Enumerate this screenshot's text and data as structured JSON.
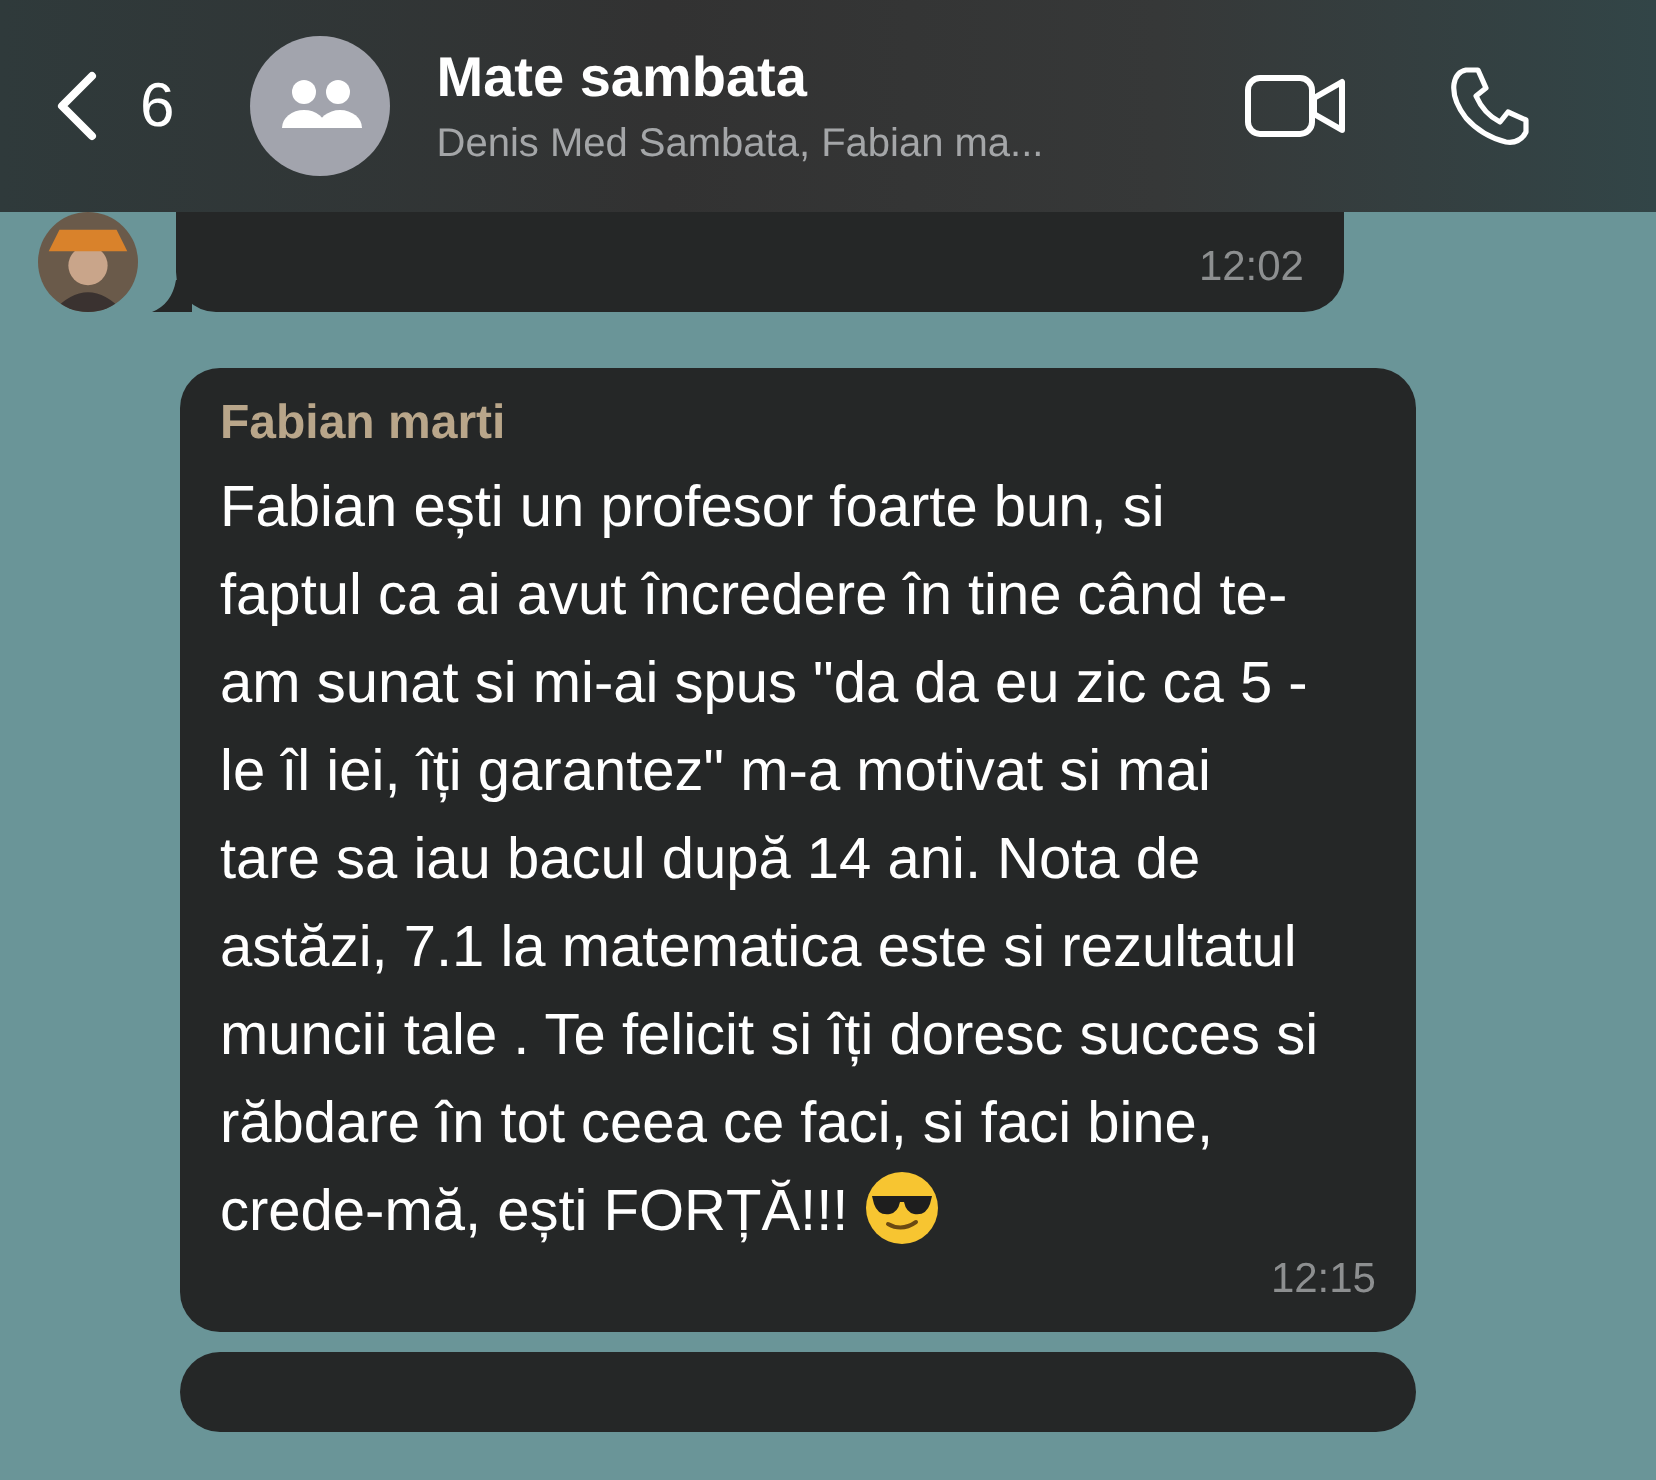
{
  "header": {
    "back_count": "6",
    "title": "Mate sambata",
    "subtitle": "Denis Med Sambata, Fabian ma..."
  },
  "messages": [
    {
      "kind": "incoming_tail",
      "time": "12:02"
    },
    {
      "kind": "incoming",
      "sender": "Fabian marti",
      "text": "Fabian ești un profesor foarte bun, si faptul ca ai avut încredere în tine când te-am sunat si mi-ai spus \"da da eu zic ca 5 -le îl iei, îți garantez\" m-a motivat si mai tare sa iau bacul după 14 ani. Nota de astăzi, 7.1 la matematica este si rezultatul muncii tale . Te felicit si îți doresc succes si răbdare în tot ceea ce faci, si faci bine, crede-mă, ești FORȚĂ!!!",
      "emoji": true,
      "time": "12:15"
    }
  ]
}
